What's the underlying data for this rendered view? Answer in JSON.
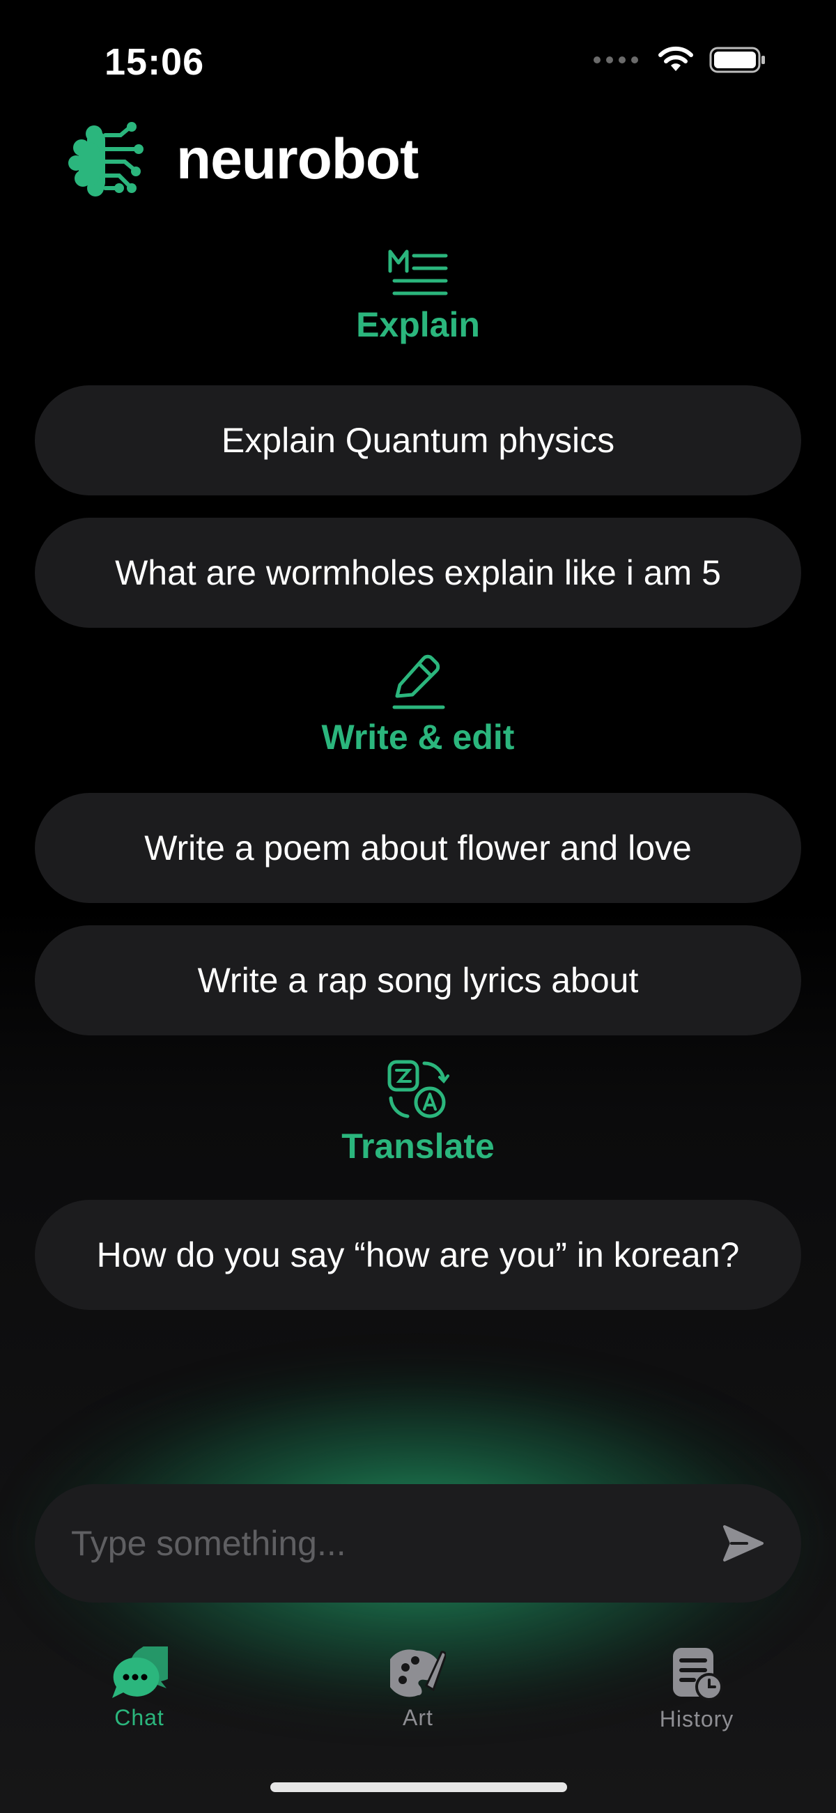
{
  "status_bar": {
    "time": "15:06"
  },
  "header": {
    "app_name": "neurobot",
    "logo_icon": "brain-circuit-icon"
  },
  "sections": {
    "explain": {
      "title": "Explain",
      "icon": "markdown-icon",
      "prompts": [
        "Explain Quantum physics",
        "What are wormholes explain like i am 5"
      ]
    },
    "write": {
      "title": "Write & edit",
      "icon": "pencil-icon",
      "prompts": [
        "Write a poem about flower and love",
        "Write a rap song lyrics about"
      ]
    },
    "translate": {
      "title": "Translate",
      "icon": "translate-icon",
      "prompts": [
        "How do you say “how are you” in korean?"
      ]
    }
  },
  "input": {
    "placeholder": "Type something..."
  },
  "tabs": [
    {
      "label": "Chat",
      "icon": "chat-bubbles-icon",
      "active": true
    },
    {
      "label": "Art",
      "icon": "palette-icon",
      "active": false
    },
    {
      "label": "History",
      "icon": "history-icon",
      "active": false
    }
  ],
  "colors": {
    "accent": "#2bb67d",
    "background": "#000000",
    "card": "#1c1c1e",
    "muted": "#8e8e93"
  }
}
